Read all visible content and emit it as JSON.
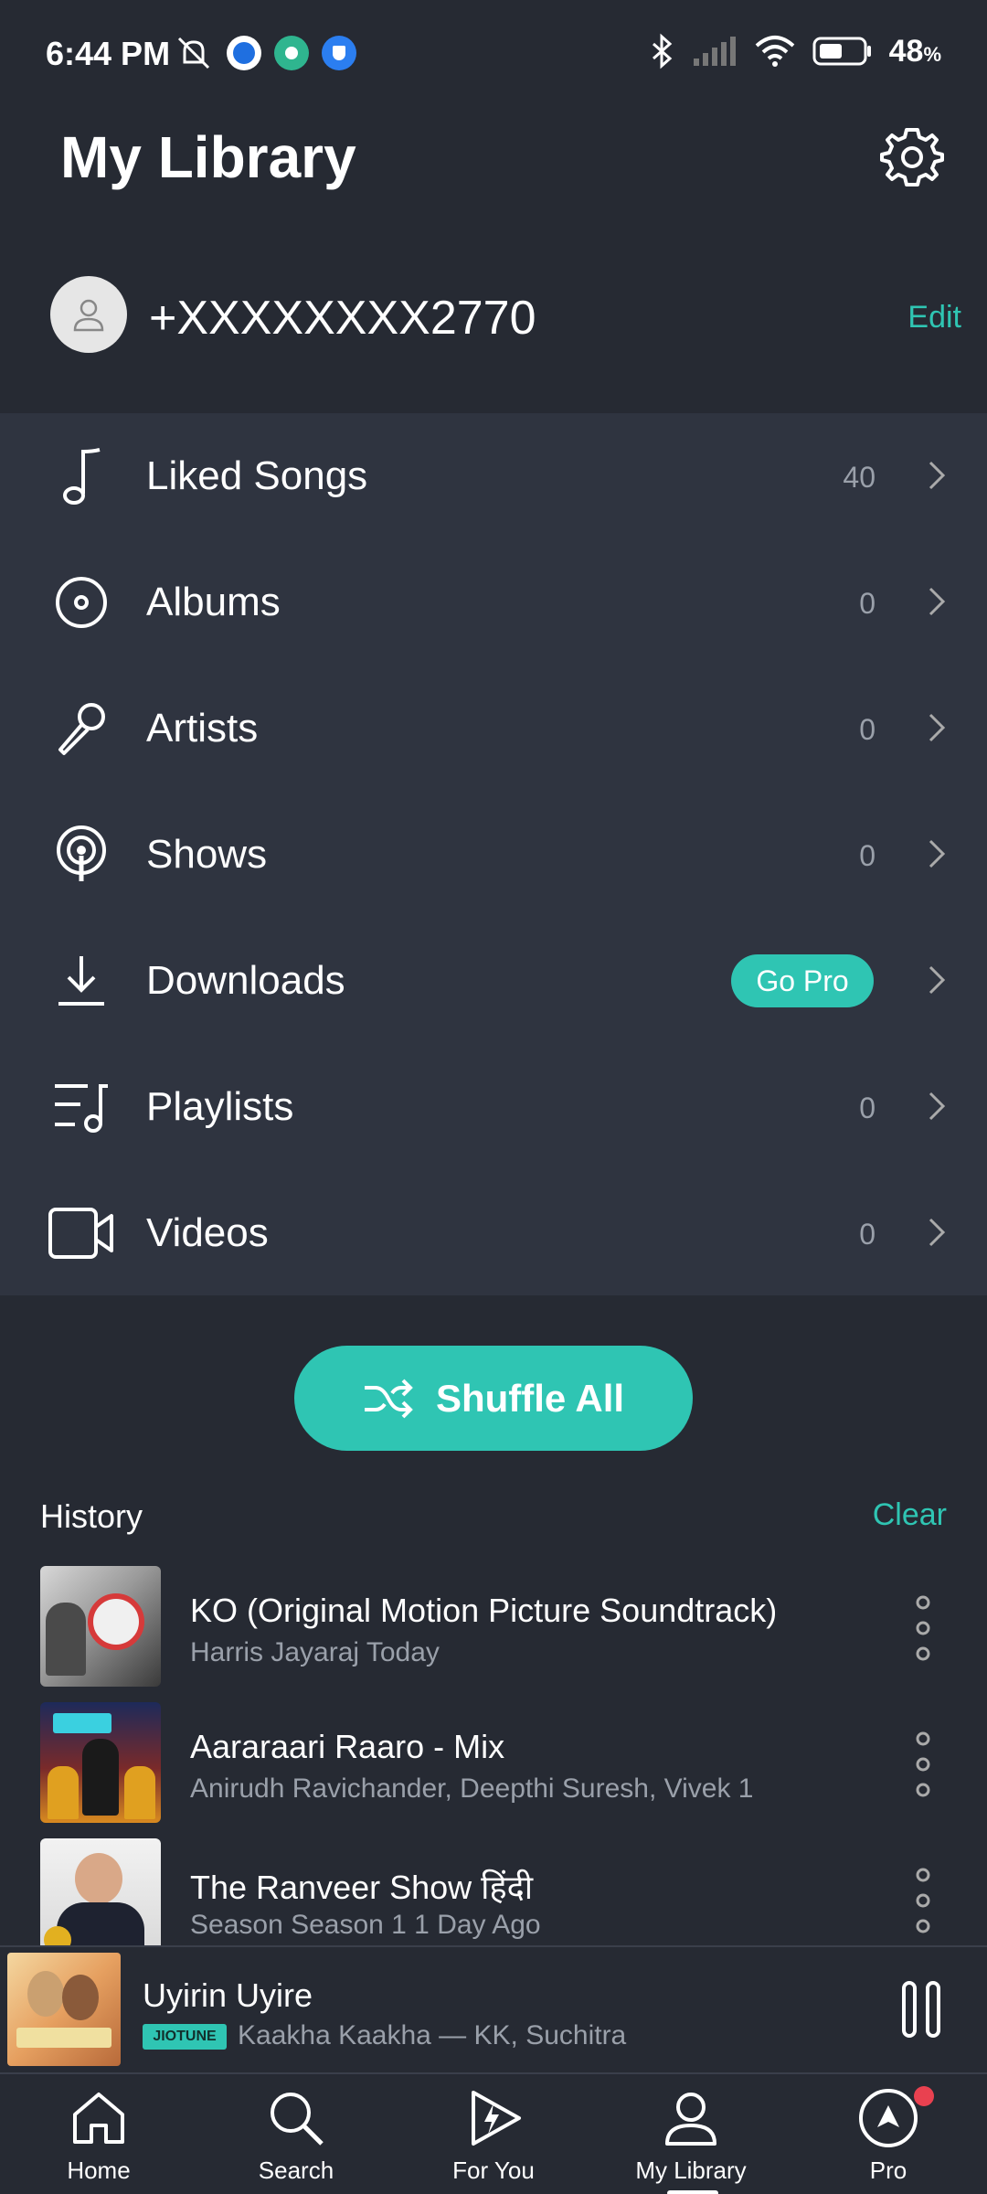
{
  "status_bar": {
    "time": "6:44 PM",
    "battery": "48",
    "battery_unit": "%"
  },
  "header": {
    "title": "My Library"
  },
  "profile": {
    "phone": "+XXXXXXXX2770",
    "edit_label": "Edit"
  },
  "library": {
    "items": [
      {
        "label": "Liked Songs",
        "count": "40",
        "icon": "music-note-icon"
      },
      {
        "label": "Albums",
        "count": "0",
        "icon": "disc-icon"
      },
      {
        "label": "Artists",
        "count": "0",
        "icon": "microphone-icon"
      },
      {
        "label": "Shows",
        "count": "0",
        "icon": "podcast-icon"
      },
      {
        "label": "Downloads",
        "badge": "Go Pro",
        "icon": "download-icon"
      },
      {
        "label": "Playlists",
        "count": "0",
        "icon": "playlist-icon"
      },
      {
        "label": "Videos",
        "count": "0",
        "icon": "video-icon"
      }
    ]
  },
  "shuffle": {
    "label": "Shuffle All"
  },
  "history": {
    "title": "History",
    "clear_label": "Clear",
    "items": [
      {
        "title": "KO (Original Motion Picture Soundtrack)",
        "subtitle": "Harris Jayaraj  Today"
      },
      {
        "title": "Aararaari Raaro - Mix",
        "subtitle": "Anirudh Ravichander, Deepthi Suresh, Vivek  1"
      },
      {
        "title": "The Ranveer Show हिंदी",
        "subtitle": "Season Season 1  1 Day Ago"
      }
    ]
  },
  "now_playing": {
    "title": "Uyirin Uyire",
    "badge": "JIOTUNE",
    "subtitle": "Kaakha Kaakha — KK, Suchitra"
  },
  "nav": {
    "items": [
      {
        "label": "Home"
      },
      {
        "label": "Search"
      },
      {
        "label": "For You"
      },
      {
        "label": "My Library"
      },
      {
        "label": "Pro"
      }
    ]
  },
  "colors": {
    "accent": "#2fc5b3",
    "background": "#262a33",
    "list_background": "#2f3440"
  }
}
